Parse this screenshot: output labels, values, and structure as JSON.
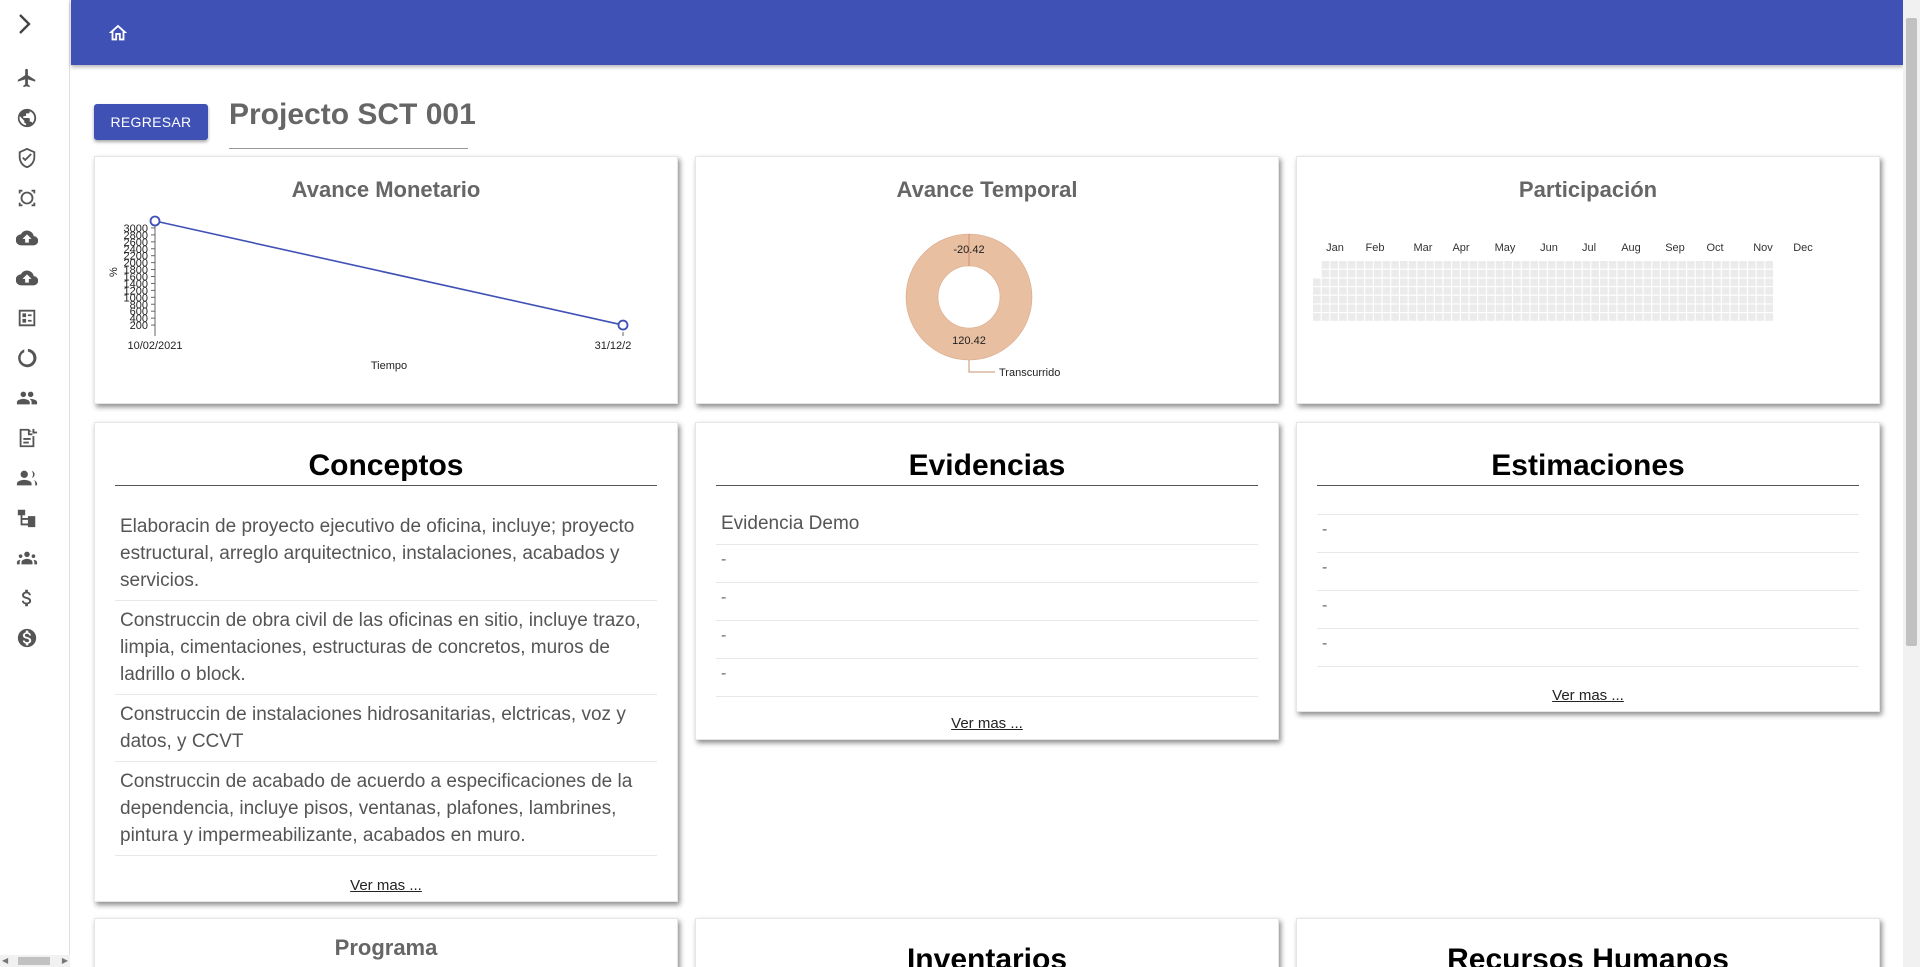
{
  "topbar": {
    "home_icon": "home-icon",
    "color": "#3f51b5"
  },
  "sidebar": {
    "toggle_icon": "chevron-right-icon",
    "items": [
      {
        "icon": "airplane-icon"
      },
      {
        "icon": "globe-icon"
      },
      {
        "icon": "shield-check-icon"
      },
      {
        "icon": "target-icon"
      },
      {
        "icon": "cloud-upload-icon"
      },
      {
        "icon": "cloud-upload-icon"
      },
      {
        "icon": "checklist-icon"
      },
      {
        "icon": "refresh-icon"
      },
      {
        "icon": "people-icon"
      },
      {
        "icon": "note-add-icon"
      },
      {
        "icon": "group-icon"
      },
      {
        "icon": "hierarchy-icon"
      },
      {
        "icon": "team-icon"
      },
      {
        "icon": "dollar-icon"
      },
      {
        "icon": "dollar-circle-icon"
      }
    ]
  },
  "header": {
    "back_label": "REGRESAR",
    "title": "Projecto SCT 001"
  },
  "cards": {
    "avance_monetario": {
      "title": "Avance Monetario",
      "chart_data": {
        "type": "line",
        "x": [
          "10/02/2021",
          "31/12/2"
        ],
        "series": [
          {
            "values": [
              3200,
              200
            ]
          }
        ],
        "xlabel": "Tiempo",
        "ylabel": "%",
        "yticks": [
          "200",
          "400",
          "600",
          "800",
          "1000",
          "1200",
          "1400",
          "1600",
          "1800",
          "2000",
          "2200",
          "2400",
          "2600",
          "2800",
          "3000"
        ],
        "ylim": [
          0,
          3200
        ],
        "color": "#3f51b5"
      }
    },
    "avance_temporal": {
      "title": "Avance Temporal",
      "chart_data": {
        "type": "pie",
        "labels": [
          "",
          "Transcurrido"
        ],
        "values": [
          -20.42,
          120.42
        ],
        "value_labels": [
          "-20.42",
          "120.42"
        ],
        "color": "#e8bfa0"
      }
    },
    "participacion": {
      "title": "Participación",
      "chart_data": {
        "type": "heatmap",
        "months": [
          "Jan",
          "Feb",
          "Mar",
          "Apr",
          "May",
          "Jun",
          "Jul",
          "Aug",
          "Sep",
          "Oct",
          "Nov",
          "Dec"
        ],
        "rows": 7,
        "cols": 53,
        "color": "#ebebeb"
      }
    },
    "conceptos": {
      "title": "Conceptos",
      "items": [
        "Elaboracin de proyecto ejecutivo de oficina, incluye; proyecto estructural, arreglo arquitectnico, instalaciones, acabados y servicios.",
        "Construccin de obra civil de las oficinas en sitio, incluye trazo, limpia, cimentaciones, estructuras de concretos, muros de ladrillo o block.",
        "Construccin de instalaciones hidrosanitarias, elctricas, voz y datos, y CCVT",
        "Construccin de acabado de acuerdo a especificaciones de la dependencia, incluye pisos, ventanas, plafones, lambrines, pintura y impermeabilizante, acabados en muro."
      ],
      "more": "Ver mas ..."
    },
    "evidencias": {
      "title": "Evidencias",
      "items": [
        "Evidencia Demo",
        "-",
        "-",
        "-",
        "-"
      ],
      "more": "Ver mas ..."
    },
    "estimaciones": {
      "title": "Estimaciones",
      "items": [
        "",
        "-",
        "-",
        "-",
        "-"
      ],
      "more": "Ver mas ..."
    },
    "programa": {
      "title": "Programa"
    },
    "inventarios": {
      "title": "Inventarios"
    },
    "recursos": {
      "title": "Recursos Humanos"
    }
  }
}
